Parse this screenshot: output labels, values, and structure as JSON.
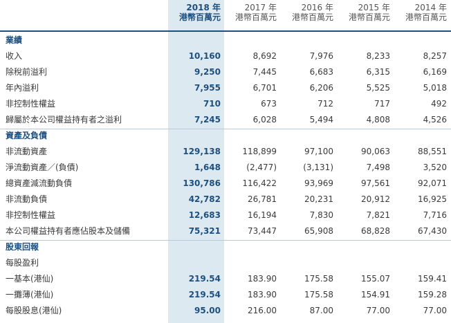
{
  "header": {
    "years": [
      "2018 年",
      "2017 年",
      "2016 年",
      "2015 年",
      "2014 年"
    ],
    "unit": "港幣百萬元"
  },
  "sections": [
    {
      "title": "業績",
      "rows": [
        {
          "label": "收入",
          "values": [
            "10,160",
            "8,692",
            "7,976",
            "8,233",
            "8,257"
          ]
        },
        {
          "label": "除稅前溢利",
          "values": [
            "9,250",
            "7,445",
            "6,683",
            "6,315",
            "6,169"
          ]
        },
        {
          "label": "年內溢利",
          "values": [
            "7,955",
            "6,701",
            "6,206",
            "5,525",
            "5,018"
          ]
        },
        {
          "label": "非控制性權益",
          "values": [
            "710",
            "673",
            "712",
            "717",
            "492"
          ]
        },
        {
          "label": "歸屬於本公司權益持有者之溢利",
          "values": [
            "7,245",
            "6,028",
            "5,494",
            "4,808",
            "4,526"
          ]
        }
      ]
    },
    {
      "title": "資產及負債",
      "rows": [
        {
          "label": "非流動資產",
          "values": [
            "129,138",
            "118,899",
            "97,100",
            "90,063",
            "88,551"
          ]
        },
        {
          "label": "淨流動資產／(負債)",
          "values": [
            "1,648",
            "(2,477)",
            "(3,131)",
            "7,498",
            "3,520"
          ]
        },
        {
          "label": "總資產減流動負債",
          "values": [
            "130,786",
            "116,422",
            "93,969",
            "97,561",
            "92,071"
          ]
        },
        {
          "label": "非流動負債",
          "values": [
            "42,782",
            "26,781",
            "20,231",
            "20,912",
            "16,925"
          ]
        },
        {
          "label": "非控制性權益",
          "values": [
            "12,683",
            "16,194",
            "7,830",
            "7,821",
            "7,716"
          ]
        },
        {
          "label": "本公司權益持有者應佔股本及儲備",
          "values": [
            "75,321",
            "73,447",
            "65,908",
            "68,828",
            "67,430"
          ]
        }
      ]
    },
    {
      "title": "股東回報",
      "rows": [
        {
          "label": "每股盈利",
          "values": [
            "",
            "",
            "",
            "",
            ""
          ]
        },
        {
          "label": "一基本(港仙)",
          "values": [
            "219.54",
            "183.90",
            "175.58",
            "155.07",
            "159.41"
          ]
        },
        {
          "label": "一攤薄(港仙)",
          "values": [
            "219.54",
            "183.90",
            "175.58",
            "154.91",
            "159.28"
          ]
        },
        {
          "label": "每股股息(港仙)",
          "values": [
            "95.00",
            "216.00",
            "87.00",
            "77.00",
            "77.00"
          ]
        }
      ]
    }
  ]
}
